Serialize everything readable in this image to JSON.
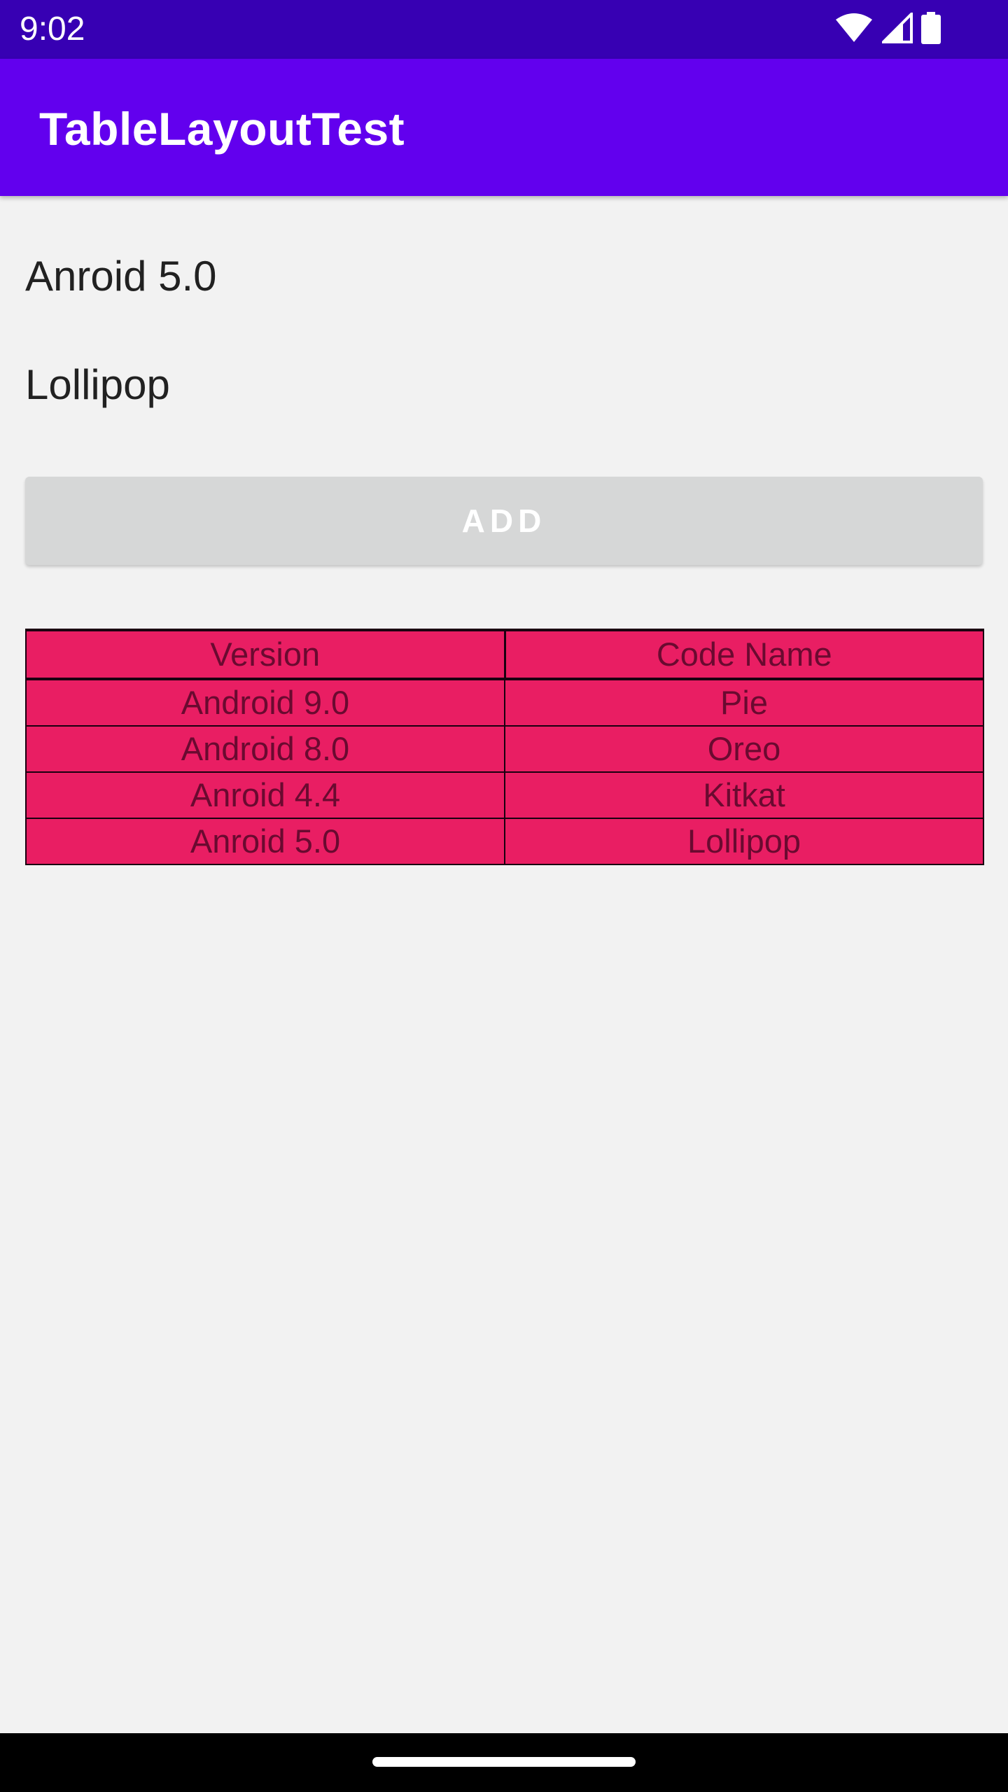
{
  "status_bar": {
    "time": "9:02",
    "icons": [
      "wifi-icon",
      "cell-signal-icon",
      "battery-icon"
    ]
  },
  "app_bar": {
    "title": "TableLayoutTest"
  },
  "content": {
    "line1": "Anroid 5.0",
    "line2": "Lollipop",
    "add_button_label": "ADD"
  },
  "table": {
    "headers": [
      "Version",
      "Code Name"
    ],
    "rows": [
      [
        "Android 9.0",
        "Pie"
      ],
      [
        "Android 8.0",
        "Oreo"
      ],
      [
        "Anroid 4.4",
        "Kitkat"
      ],
      [
        "Anroid 5.0",
        "Lollipop"
      ]
    ]
  },
  "colors": {
    "status_bar": "#3700b3",
    "app_bar": "#6200ee",
    "table_background": "#e91e63",
    "button_background": "#d6d7d7",
    "page_background": "#f2f2f2"
  }
}
